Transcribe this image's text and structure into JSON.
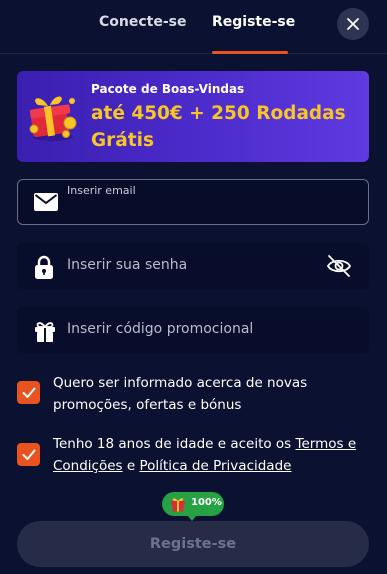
{
  "tabs": {
    "login": "Conecte-se",
    "register": "Registe-se"
  },
  "banner": {
    "title": "Pacote de Boas-Vindas",
    "offer": "até 450€ + 250 Rodadas Grátis"
  },
  "form": {
    "email_label": "Inserir email",
    "email_value": "",
    "password_placeholder": "Inserir sua senha",
    "promo_placeholder": "Inserir código promocional"
  },
  "consents": {
    "marketing": "Quero ser informado acerca de novas promoções, ofertas e bónus",
    "age_prefix": "Tenho 18 anos de idade e aceito os ",
    "terms_link": "Termos e Condições",
    "conjunction": " e ",
    "privacy_link": "Política de Privacidade"
  },
  "progress": {
    "label": "100%",
    "value": 1.0
  },
  "submit_label": "Registe-se",
  "icons": {
    "close": "close-icon",
    "gift_banner": "gift-box-icon",
    "email": "envelope-icon",
    "password": "lock-icon",
    "toggle_password": "eye-off-icon",
    "promo": "gift-icon",
    "check": "checkmark-icon"
  },
  "colors": {
    "background": "#0b1130",
    "accent": "#e8531f",
    "banner_highlight": "#f8c528",
    "progress": "#26a143"
  }
}
